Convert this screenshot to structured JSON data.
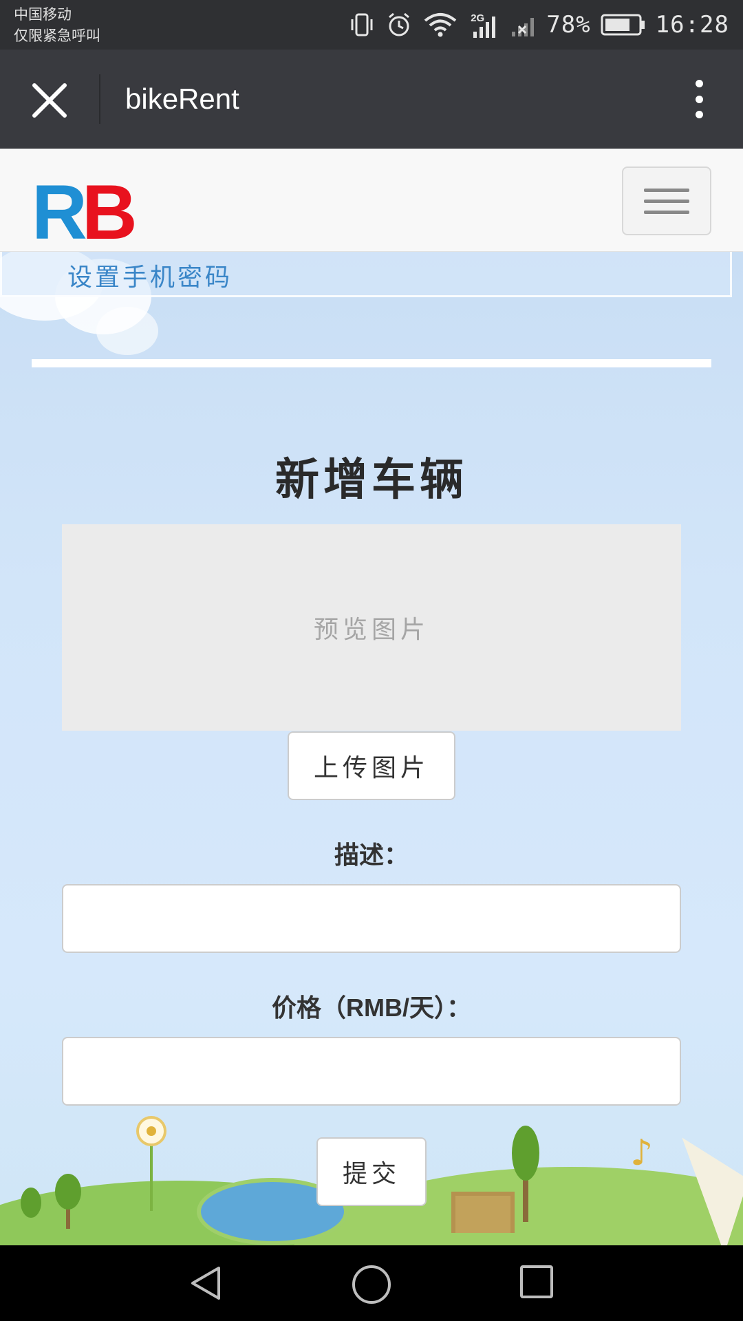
{
  "status_bar": {
    "carrier_line1": "中国移动",
    "carrier_line2": "仅限紧急呼叫",
    "network_type": "2G",
    "battery_percent": "78%",
    "time": "16:28",
    "icons": [
      "vibrate-icon",
      "alarm-icon",
      "wifi-icon",
      "signal-icon",
      "no-signal-icon",
      "battery-icon"
    ]
  },
  "title_bar": {
    "title": "bikeRent",
    "close_icon": "close-icon",
    "more_icon": "more-vertical-icon"
  },
  "navbar": {
    "logo_r": "R",
    "logo_b": "B",
    "menu_icon": "hamburger-icon",
    "link": "设置手机密码"
  },
  "form": {
    "title": "新增车辆",
    "preview_text": "预览图片",
    "upload_label": "上传图片",
    "description_label": "描述：",
    "description_value": "",
    "price_label": "价格（RMB/天）：",
    "price_value": "",
    "submit_label": "提交"
  },
  "colors": {
    "logo_r": "#1f8fd4",
    "logo_b": "#e8121e",
    "link": "#3a86c8",
    "title_bar": "#393a3f",
    "status_bar": "#2f3033"
  },
  "system_nav": {
    "icons": [
      "back-icon",
      "home-icon",
      "recents-icon"
    ]
  }
}
